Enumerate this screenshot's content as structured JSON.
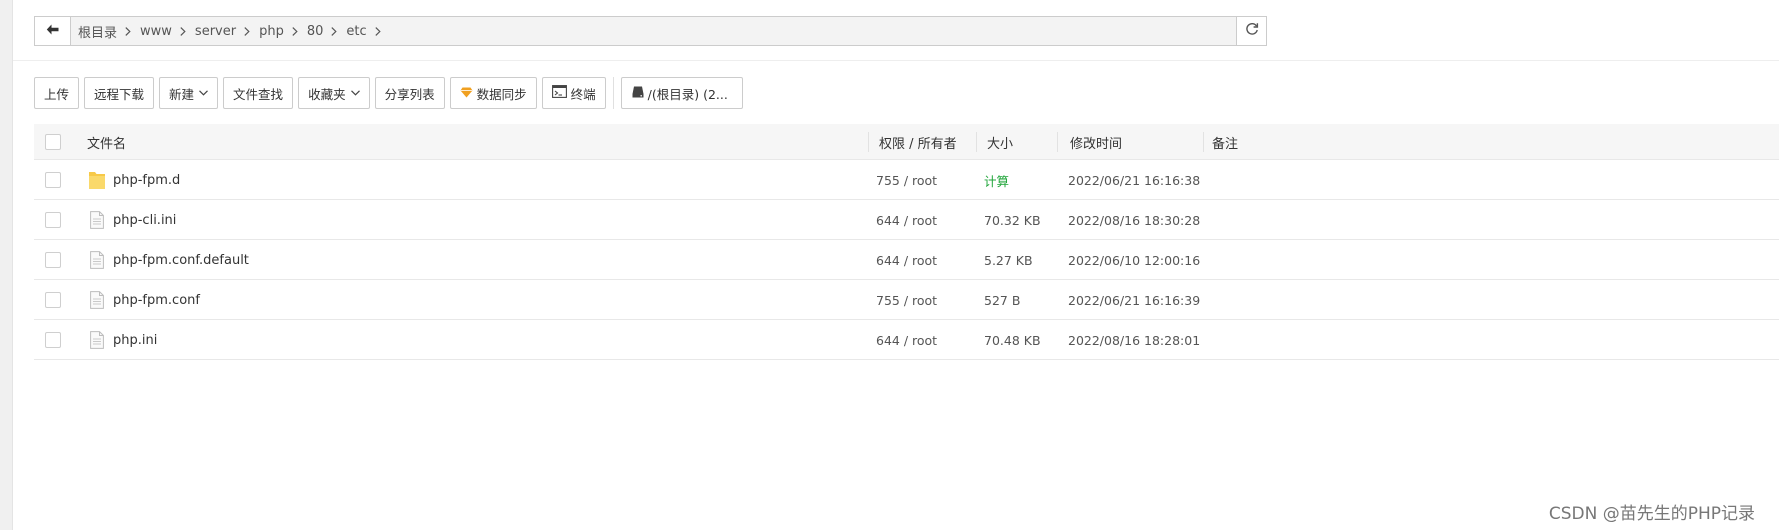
{
  "path": {
    "crumbs": [
      "根目录",
      "www",
      "server",
      "php",
      "80",
      "etc"
    ]
  },
  "toolbar": {
    "upload": "上传",
    "remote_download": "远程下载",
    "new": "新建",
    "file_search": "文件查找",
    "favorites": "收藏夹",
    "share_list": "分享列表",
    "data_sync": "数据同步",
    "terminal": "终端",
    "disk": "/(根目录) (2..."
  },
  "table": {
    "headers": {
      "name": "文件名",
      "perm_owner": "权限 / 所有者",
      "size": "大小",
      "mtime": "修改时间",
      "note": "备注"
    },
    "rows": [
      {
        "name": "php-fpm.d",
        "type": "folder",
        "perm": "755 / root",
        "size": "计算",
        "mtime": "2022/06/21 16:16:38"
      },
      {
        "name": "php-cli.ini",
        "type": "file",
        "perm": "644 / root",
        "size": "70.32 KB",
        "mtime": "2022/08/16 18:30:28"
      },
      {
        "name": "php-fpm.conf.default",
        "type": "file",
        "perm": "644 / root",
        "size": "5.27 KB",
        "mtime": "2022/06/10 12:00:16"
      },
      {
        "name": "php-fpm.conf",
        "type": "file",
        "perm": "755 / root",
        "size": "527 B",
        "mtime": "2022/06/21 16:16:39"
      },
      {
        "name": "php.ini",
        "type": "file",
        "perm": "644 / root",
        "size": "70.48 KB",
        "mtime": "2022/08/16 18:28:01"
      }
    ]
  },
  "watermark": "CSDN @苗先生的PHP记录",
  "colors": {
    "accent_green": "#20a53a",
    "folder_yellow": "#f7c948",
    "data_sync_orange": "#f0a020"
  }
}
